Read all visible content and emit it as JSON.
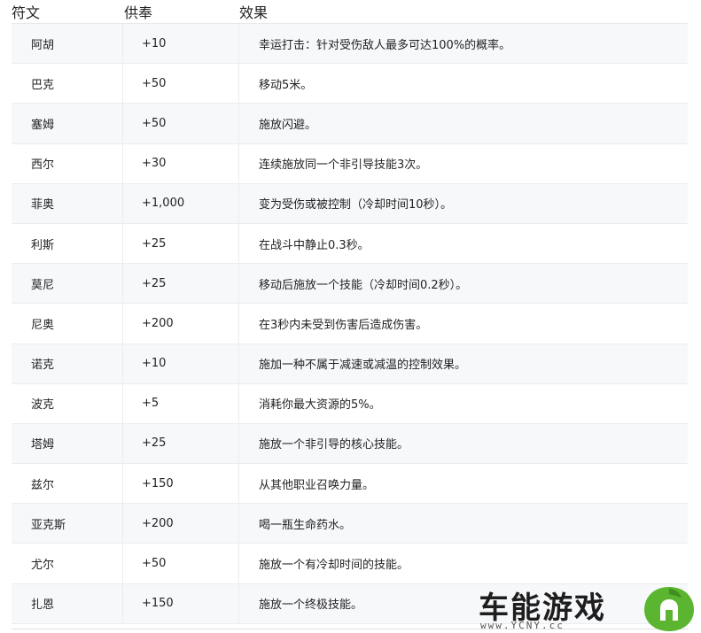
{
  "headers": {
    "rune": "符文",
    "offering": "供奉",
    "effect": "效果"
  },
  "rows": [
    {
      "rune": "阿胡",
      "offering": "+10",
      "effect": "幸运打击：针对受伤敌人最多可达100%的概率。"
    },
    {
      "rune": "巴克",
      "offering": "+50",
      "effect": "移动5米。"
    },
    {
      "rune": "塞姆",
      "offering": "+50",
      "effect": "施放闪避。"
    },
    {
      "rune": "西尔",
      "offering": "+30",
      "effect": "连续施放同一个非引导技能3次。"
    },
    {
      "rune": "菲奥",
      "offering": "+1,000",
      "effect": "变为受伤或被控制（冷却时间10秒）。"
    },
    {
      "rune": "利斯",
      "offering": "+25",
      "effect": "在战斗中静止0.3秒。"
    },
    {
      "rune": "莫尼",
      "offering": "+25",
      "effect": "移动后施放一个技能（冷却时间0.2秒）。"
    },
    {
      "rune": "尼奥",
      "offering": "+200",
      "effect": "在3秒内未受到伤害后造成伤害。"
    },
    {
      "rune": "诺克",
      "offering": "+10",
      "effect": "施加一种不属于减速或减温的控制效果。"
    },
    {
      "rune": "波克",
      "offering": "+5",
      "effect": "消耗你最大资源的5%。"
    },
    {
      "rune": "塔姆",
      "offering": "+25",
      "effect": "施放一个非引导的核心技能。"
    },
    {
      "rune": "兹尔",
      "offering": "+150",
      "effect": "从其他职业召唤力量。"
    },
    {
      "rune": "亚克斯",
      "offering": "+200",
      "effect": "喝一瓶生命药水。"
    },
    {
      "rune": "尤尔",
      "offering": "+50",
      "effect": "施放一个有冷却时间的技能。"
    },
    {
      "rune": "扎恩",
      "offering": "+150",
      "effect": "施放一个终极技能。"
    }
  ],
  "watermark": {
    "name": "车能游戏",
    "url": "www.YCNY.cc",
    "logo_color": "#5cb531"
  }
}
